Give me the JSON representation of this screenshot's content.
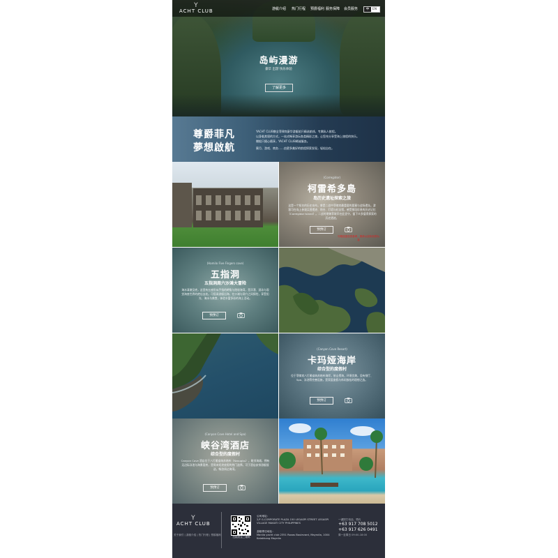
{
  "header": {
    "logo_text": "ACHT CLUB",
    "nav": [
      "游艇介绍",
      "热门行程",
      "预爵福利",
      "服务保障",
      "会员服务"
    ],
    "lang": [
      "中",
      "EN"
    ]
  },
  "hero": {
    "title": "岛屿漫游",
    "subtitle": "豪华 出游 快乐体验",
    "button": "了解更多"
  },
  "intro": {
    "title1": "尊爵菲凡",
    "title2": "夢想啟航",
    "para1": "YACHT CLUB携全菲律宾豪华游艇船只精选航线，专属私人航程。",
    "para2": "以身临其境的方式，一站式畅享游玩各类精彩之旅，让您充分享受海上旅程的快乐。",
    "para3": "赠船只随心随享，YACHT CLUB竭诚服务。",
    "para4": "蜜月、游戏、商务……由更多美好的航程探索发现，轻松自在。"
  },
  "sections": [
    {
      "en": "(Corregidor)",
      "title": "柯雷希多島",
      "subtitle": "岛历史遗址探索之旅",
      "desc": "这是一个知名的历史岛屿，曾是二战中菲律宾最重要的要塞与战场遗址。游客可在岛上参观兵营遗迹、炮台、灯塔与纪念馆，感受那段珍贵的历史记忆（Corregidor Island）。二战时期美菲联军在此坚守，留下众多值得探索的历史遗迹。",
      "button": "预预订",
      "note": "行程信息仅供参考，具体以实际安排为准"
    },
    {
      "en": "(Hamilo Five Fingers cove)",
      "title": "五指洞",
      "subtitle": "五指洞周六沙滩大冒险",
      "desc": "海水清澈见底，这里有五座形似手指的岬角与隐秘海湾，是浮潜、游泳与观赏海底世界的绝佳去处。可搭乘游艇出海，在沙滩与洞穴之间探险，享受阳光、海水与美食，体验丰富多彩的海上活动。",
      "button": "预预订"
    },
    {
      "en": "(Canyon Cove Resort)",
      "title": "卡玛娅海岸",
      "subtitle": "综合型的度假村",
      "desc": "位于菲律宾八打雁省纳苏格布海岸，依山傍海，环境优美，设有餐厅、Spa、泳池等完善设施，是家庭度假与休闲放松的理想之选。",
      "button": "预预订"
    },
    {
      "en": "(Canyon Cove Hotel and Spa)",
      "title": "峡谷湾酒店",
      "subtitle": "综合型的度假村",
      "desc": "Canyon Cove 酒店位于八打雁省纳苏格布（Nasugbu），毗邻海滩，拥有无边际泳池与海景客房，是周末短途度假的热门选择。可于酒店安排游艇接送，畅游周边海湾。",
      "button": "预预订"
    }
  ],
  "footer": {
    "logo_text": "ACHT CLUB",
    "links": "关于我们 | 游艇介绍 | 热门行程 | 预爵福利",
    "qr_label": "扫描关注二维码",
    "addr_label": "公司地址：",
    "addr": "2/F G.CORPORATE PLAZA 150 LEGASPI STREET LEGASPI VILLAGE MAKATI CITY PHILIPPINES",
    "marina_label": "游艇停泊地址：",
    "marina": "Manila yacht club 2351 Roxas Boulevard, Mayrolla, 1004 Kalakhang Maynila",
    "phone_label": "一键拨打电话，预约",
    "phone1": "+63 917 708 5012",
    "phone2": "+63 917 626 0491",
    "hours": "周一至周日 09:00-18:00"
  }
}
